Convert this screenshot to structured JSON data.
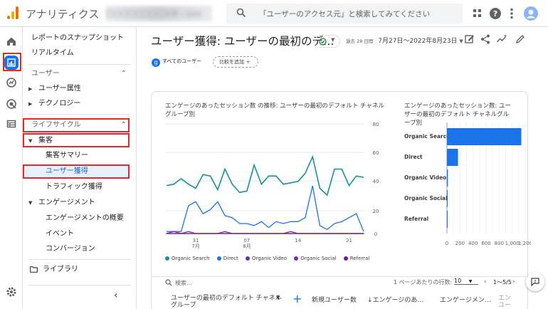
{
  "app": {
    "title": "アナリティクス",
    "account_name": "〇〇〇〇〇〇〇〇大学 – GA4"
  },
  "search": {
    "placeholder": "「ユーザーのアクセス元」と検索してみてください"
  },
  "topbar_icons": [
    "apps-icon",
    "help-icon",
    "more-vert-icon",
    "account-avatar"
  ],
  "rail": [
    "home-icon",
    "reports-icon",
    "explore-icon",
    "advertising-icon",
    "configure-icon",
    "settings-icon"
  ],
  "nav": {
    "snapshot": "レポートのスナップショット",
    "realtime": "リアルタイム",
    "user_section": "ユーザー",
    "user_attributes": "ユーザー属性",
    "technology": "テクノロジー",
    "lifecycle_section": "ライフサイクル",
    "acquisition": "集客",
    "acquisition_overview": "集客サマリー",
    "user_acquisition": "ユーザー獲得",
    "traffic_acquisition": "トラフィック獲得",
    "engagement": "エンゲージメント",
    "engagement_overview": "エンゲージメントの概要",
    "events": "イベント",
    "conversions": "コンバージョン",
    "library": "ライブラリ",
    "collapse": "‹"
  },
  "header": {
    "title": "ユーザー獲得: ユーザーの最初のデ…",
    "date_prefix": "過去 28 日間",
    "date_range": "7月27日～2022年8月23日",
    "filter_chip": "すべてのユーザー",
    "add_comparison": "比較を追加 ＋"
  },
  "line_chart": {
    "title": "エンゲージのあったセッション数 の推移: ユーザーの最初のデフォルト チャネルグループ別",
    "x_ticks": [
      "31\n7月",
      "07\n8月",
      "14",
      "21"
    ],
    "y_ticks_right_top": [
      "80",
      "60",
      "40"
    ],
    "y_ticks_right_bottom": [
      "20",
      "0"
    ]
  },
  "bar_chart": {
    "title": "エンゲージのあったセッション数: ユーザーの最初のデフォルト チャネルグループ別",
    "x_ticks": [
      "0",
      "200",
      "400",
      "600",
      "800",
      "1,000",
      "1,200"
    ]
  },
  "legend": [
    "Organic Search",
    "Direct",
    "Organic Video",
    "Organic Social",
    "Referral"
  ],
  "table": {
    "search_placeholder": "検索...",
    "rows_per_page_label": "1 ページあたりの行数:",
    "rows_per_page_value": "10",
    "pagination": "1～5/5",
    "col_dimension": "ユーザーの最初のデフォルト チャネル\nグループ",
    "col_new_users": "新規ユーザー数",
    "col_engaged": "↓エンゲージのあ…",
    "col_engagement": "エンゲージメン…",
    "col_more": "エン\nユー"
  },
  "colors": {
    "organic_search": "#12939a",
    "direct": "#1a73e8",
    "organic_video": "#5e35b1",
    "organic_social": "#8e24aa",
    "referral": "#6a1b9a",
    "bar": "#1a73e8",
    "highlight_box": "#e02b2b"
  },
  "chart_data": [
    {
      "type": "line",
      "title": "エンゲージのあったセッション数 の推移: ユーザーの最初のデフォルト チャネルグループ別",
      "x": [
        "7/27",
        "7/28",
        "7/29",
        "7/30",
        "7/31",
        "8/1",
        "8/2",
        "8/3",
        "8/4",
        "8/5",
        "8/6",
        "8/7",
        "8/8",
        "8/9",
        "8/10",
        "8/11",
        "8/12",
        "8/13",
        "8/14",
        "8/15",
        "8/16",
        "8/17",
        "8/18",
        "8/19",
        "8/20",
        "8/21",
        "8/22",
        "8/23"
      ],
      "ylim": [
        0,
        80
      ],
      "series": [
        {
          "name": "Organic Search",
          "values": [
            35,
            36,
            40,
            36,
            33,
            43,
            42,
            32,
            47,
            36,
            30,
            31,
            50,
            36,
            42,
            42,
            36,
            37,
            38,
            44,
            56,
            33,
            28,
            47,
            47,
            35,
            42,
            41
          ]
        },
        {
          "name": "Direct",
          "values": [
            1,
            1,
            1,
            14,
            16,
            10,
            12,
            16,
            9,
            8,
            5,
            5,
            4,
            6,
            3,
            6,
            5,
            6,
            6,
            8,
            24,
            4,
            2,
            5,
            6,
            8,
            10,
            1
          ]
        },
        {
          "name": "Organic Video",
          "values": [
            0,
            0,
            0,
            0,
            0,
            0,
            0,
            0,
            0,
            0,
            0,
            0,
            0,
            0,
            0,
            0,
            0,
            0,
            0,
            0,
            0,
            0,
            0,
            0,
            0,
            0,
            0,
            0
          ]
        },
        {
          "name": "Organic Social",
          "values": [
            0,
            1,
            0,
            1,
            0,
            0,
            0,
            0,
            1,
            0,
            0,
            0,
            0,
            0,
            0,
            0,
            0,
            1,
            0,
            0,
            0,
            0,
            0,
            0,
            0,
            0,
            0,
            0
          ]
        },
        {
          "name": "Referral",
          "values": [
            0,
            0,
            0,
            0,
            0,
            0,
            0,
            0,
            0,
            0,
            0,
            0,
            0,
            0,
            0,
            0,
            0,
            0,
            0,
            0,
            0,
            0,
            0,
            0,
            0,
            0,
            0,
            0
          ]
        }
      ]
    },
    {
      "type": "bar",
      "title": "エンゲージのあったセッション数: ユーザーの最初のデフォルト チャネルグループ別",
      "categories": [
        "Organic Search",
        "Direct",
        "Organic Video",
        "Organic Social",
        "Referral"
      ],
      "values": [
        1140,
        170,
        15,
        5,
        2
      ],
      "xlim": [
        0,
        1200
      ]
    }
  ]
}
